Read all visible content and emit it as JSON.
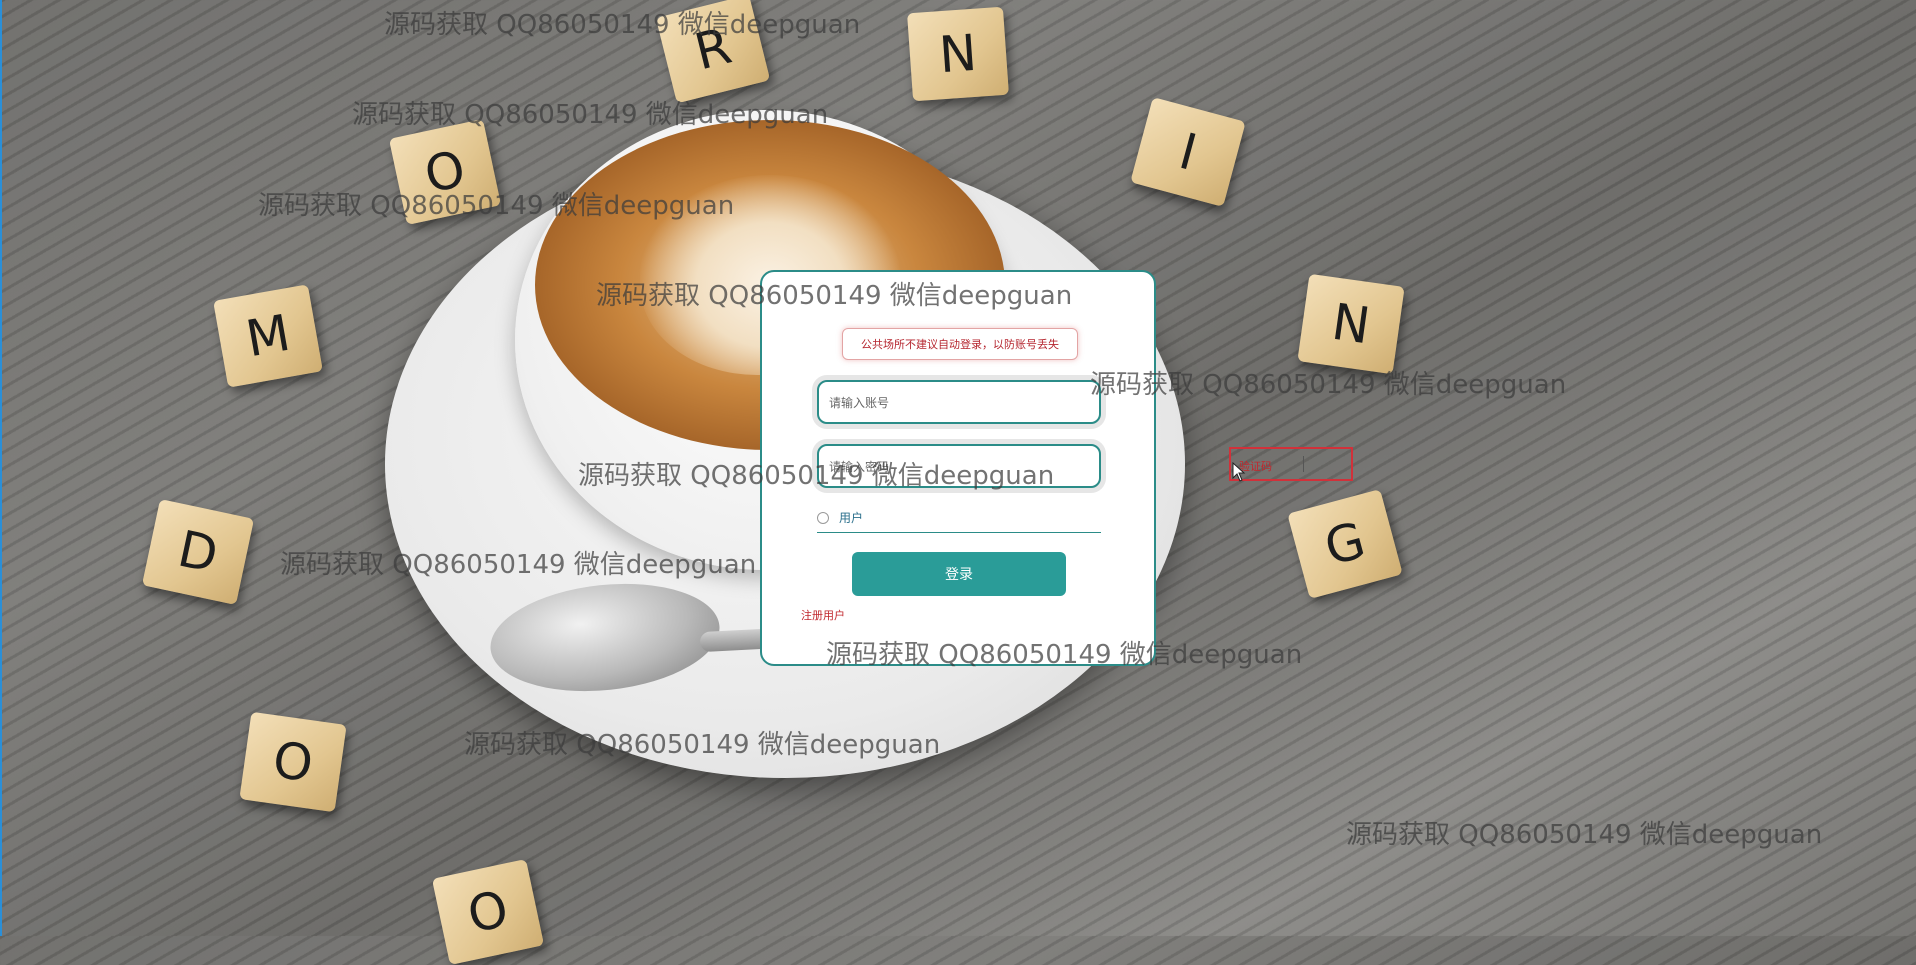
{
  "login": {
    "notice": "公共场所不建议自动登录，以防账号丢失",
    "account_placeholder": "请输入账号",
    "password_placeholder": "请输入密码",
    "role_option": "用户",
    "login_button": "登录",
    "register_link": "注册用户"
  },
  "side_box": {
    "text": "验证码"
  },
  "watermark": "源码获取 QQ86050149 微信deepguan",
  "tiles": [
    "R",
    "N",
    "O",
    "I",
    "M",
    "N",
    "D",
    "G",
    "O",
    "O"
  ],
  "colors": {
    "accent": "#2a9c98",
    "warning": "#c1272d"
  }
}
